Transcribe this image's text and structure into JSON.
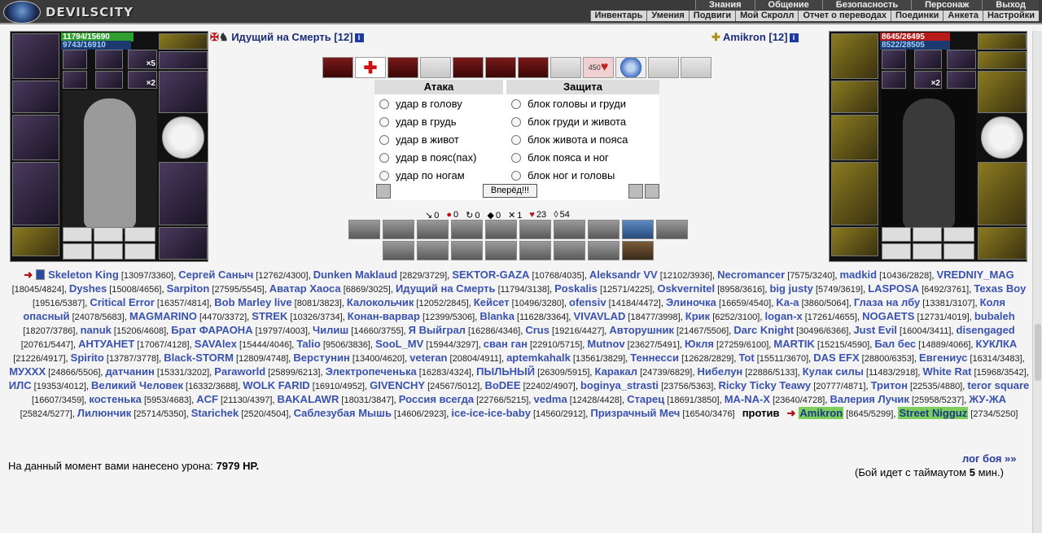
{
  "header": {
    "logo_text": "DEVILSCITY",
    "menu_top": [
      "Знания",
      "Общение",
      "Безопасность",
      "Персонаж",
      "Выход"
    ],
    "menu_bottom": [
      "Инвентарь",
      "Умения",
      "Подвиги",
      "Мой Скролл",
      "Отчет о переводах",
      "Поединки",
      "Анкета",
      "Настройки"
    ]
  },
  "player": {
    "name": "Идущий на Смерть",
    "level": "[12]",
    "hp": "11794/15690",
    "mp": "9743/16910",
    "hp_fraction": 0.752,
    "mp_fraction": 0.576,
    "slot_badges": [
      "×5",
      "×2"
    ]
  },
  "opponent": {
    "name": "Amikron",
    "level": "[12]",
    "hp": "8645/26495",
    "mp": "8522/28505",
    "hp_fraction": 0.326,
    "mp_fraction": 0.299,
    "slot_badges": [
      "×2"
    ]
  },
  "actions": {
    "heart_count": "450"
  },
  "attack": {
    "title": "Атака",
    "options": [
      "удар в голову",
      "удар в грудь",
      "удар в живот",
      "удар в пояс(пах)",
      "удар по ногам"
    ]
  },
  "defense": {
    "title": "Защита",
    "options": [
      "блок головы и груди",
      "блок груди и живота",
      "блок живота и пояса",
      "блок пояса и ног",
      "блок ног и головы"
    ]
  },
  "forward_button": "Вперёд!!!",
  "stats": [
    {
      "icon": "sword-icon",
      "glyph": "↘",
      "value": "0"
    },
    {
      "icon": "blood-icon",
      "glyph": "●",
      "value": "0"
    },
    {
      "icon": "dodge-icon",
      "glyph": "↻",
      "value": "0"
    },
    {
      "icon": "block-icon",
      "glyph": "◆",
      "value": "0"
    },
    {
      "icon": "crit-icon",
      "glyph": "✕",
      "value": "1"
    },
    {
      "icon": "heart-icon",
      "glyph": "♥",
      "value": "23"
    },
    {
      "icon": "shield-icon",
      "glyph": "◊",
      "value": "54"
    }
  ],
  "roster": {
    "team1": [
      {
        "name": "Skeleton King",
        "score": "[13097/3360]"
      },
      {
        "name": "Сергей Саныч",
        "score": "[12762/4300]"
      },
      {
        "name": "Dunken Maklaud",
        "score": "[2829/3729]"
      },
      {
        "name": "SEKTOR-GAZA",
        "score": "[10768/4035]"
      },
      {
        "name": "Aleksandr VV",
        "score": "[12102/3936]"
      },
      {
        "name": "Necromancer",
        "score": "[7575/3240]"
      },
      {
        "name": "madkid",
        "score": "[10436/2828]"
      },
      {
        "name": "VREDNIY_MAG",
        "score": "[18045/4824]"
      },
      {
        "name": "Dyshes",
        "score": "[15008/4656]"
      },
      {
        "name": "Sarpiton",
        "score": "[27595/5545]"
      },
      {
        "name": "Аватар Хаоса",
        "score": "[6869/3025]"
      },
      {
        "name": "Идущий на Смерть",
        "score": "[11794/3138]"
      },
      {
        "name": "Poskalis",
        "score": "[12571/4225]"
      },
      {
        "name": "Oskvernitel",
        "score": "[8958/3616]"
      },
      {
        "name": "big justy",
        "score": "[5749/3619]"
      },
      {
        "name": "LASPOSA",
        "score": "[6492/3761]"
      },
      {
        "name": "Texas Boy",
        "score": "[19516/5387]"
      },
      {
        "name": "Critical Error",
        "score": "[16357/4814]"
      },
      {
        "name": "Bob Marley live",
        "score": "[8081/3823]"
      },
      {
        "name": "Калокольчик",
        "score": "[12052/2845]"
      },
      {
        "name": "Кейсет",
        "score": "[10496/3280]"
      },
      {
        "name": "ofensiv",
        "score": "[14184/4472]"
      },
      {
        "name": "Элиночка",
        "score": "[16659/4540]"
      },
      {
        "name": "Ka-a",
        "score": "[3860/5064]"
      },
      {
        "name": "Глаза на лбу",
        "score": "[13381/3107]"
      },
      {
        "name": "Коля опасный",
        "score": "[24078/5683]"
      },
      {
        "name": "MAGMARINO",
        "score": "[4470/3372]"
      },
      {
        "name": "STREK",
        "score": "[10326/3734]"
      },
      {
        "name": "Конан-варвар",
        "score": "[12399/5306]"
      },
      {
        "name": "Blanka",
        "score": "[11628/3364]"
      },
      {
        "name": "VIVAVLAD",
        "score": "[18477/3998]"
      },
      {
        "name": "Крик",
        "score": "[6252/3100]"
      },
      {
        "name": "logan-x",
        "score": "[17261/4655]"
      },
      {
        "name": "NOGAETS",
        "score": "[12731/4019]"
      },
      {
        "name": "bubaleh",
        "score": "[18207/3786]"
      },
      {
        "name": "nanuk",
        "score": "[15206/4608]"
      },
      {
        "name": "Брат ФАРАОНА",
        "score": "[19797/4003]"
      },
      {
        "name": "Чилиш",
        "score": "[14660/3755]"
      },
      {
        "name": "Я Выйграл",
        "score": "[16286/4346]"
      },
      {
        "name": "Crus",
        "score": "[19216/4427]"
      },
      {
        "name": "Авторушник",
        "score": "[21467/5506]"
      },
      {
        "name": "Darc Knight",
        "score": "[30496/6366]"
      },
      {
        "name": "Just Evil",
        "score": "[16004/3411]"
      },
      {
        "name": "disengaged",
        "score": "[20761/5447]"
      },
      {
        "name": "АНТУАНЕТ",
        "score": "[17067/4128]"
      },
      {
        "name": "SAVAlex",
        "score": "[15444/4046]"
      },
      {
        "name": "Talio",
        "score": "[9506/3836]"
      },
      {
        "name": "SooL_MV",
        "score": "[15944/3297]"
      },
      {
        "name": "сван ган",
        "score": "[22910/5715]"
      },
      {
        "name": "Mutnov",
        "score": "[23627/5491]"
      },
      {
        "name": "Юкля",
        "score": "[27259/6100]"
      },
      {
        "name": "MARTIK",
        "score": "[15215/4590]"
      },
      {
        "name": "Бал бес",
        "score": "[14889/4066]"
      },
      {
        "name": "КУКЛКА",
        "score": "[21226/4917]"
      },
      {
        "name": "Spirito",
        "score": "[13787/3778]"
      },
      {
        "name": "Black-STORM",
        "score": "[12809/4748]"
      },
      {
        "name": "Верстунин",
        "score": "[13400/4620]"
      },
      {
        "name": "veteran",
        "score": "[20804/4911]"
      },
      {
        "name": "aptemkahalk",
        "score": "[13561/3829]"
      },
      {
        "name": "Теннесси",
        "score": "[12628/2829]"
      },
      {
        "name": "Tot",
        "score": "[15511/3670]"
      },
      {
        "name": "DAS EFX",
        "score": "[28800/6353]"
      },
      {
        "name": "Евгениус",
        "score": "[16314/3483]"
      },
      {
        "name": "МУХХХ",
        "score": "[24866/5506]"
      },
      {
        "name": "датчанин",
        "score": "[15331/3202]"
      },
      {
        "name": "Paraworld",
        "score": "[25899/6213]"
      },
      {
        "name": "Электропеченька",
        "score": "[16283/4324]"
      },
      {
        "name": "ПЫЛЬНЫЙ",
        "score": "[26309/5915]"
      },
      {
        "name": "Каракал",
        "score": "[24739/6829]"
      },
      {
        "name": "Нибелун",
        "score": "[22886/5133]"
      },
      {
        "name": "Кулак силы",
        "score": "[11483/2918]"
      },
      {
        "name": "White Rat",
        "score": "[15968/3542]"
      },
      {
        "name": "ИЛС",
        "score": "[19353/4012]"
      },
      {
        "name": "Великий Человек",
        "score": "[16332/3688]"
      },
      {
        "name": "WOLK FARID",
        "score": "[16910/4952]"
      },
      {
        "name": "GIVENCHY",
        "score": "[24567/5012]"
      },
      {
        "name": "BoDEE",
        "score": "[22402/4907]"
      },
      {
        "name": "boginya_strasti",
        "score": "[23756/5363]"
      },
      {
        "name": "Ricky Ticky Teawy",
        "score": "[20777/4871]"
      },
      {
        "name": "Тритон",
        "score": "[22535/4880]"
      },
      {
        "name": "teror square",
        "score": "[16607/3459]"
      },
      {
        "name": "костенька",
        "score": "[5953/4683]"
      },
      {
        "name": "ACF",
        "score": "[21130/4397]"
      },
      {
        "name": "BAKALAWR",
        "score": "[18031/3847]"
      },
      {
        "name": "Россия всегда",
        "score": "[22766/5215]"
      },
      {
        "name": "vedma",
        "score": "[12428/4428]"
      },
      {
        "name": "Старец",
        "score": "[18691/3850]"
      },
      {
        "name": "MA-NA-X",
        "score": "[23640/4728]"
      },
      {
        "name": "Валерия Лучик",
        "score": "[25958/5237]"
      },
      {
        "name": "ЖУ-ЖА",
        "score": "[25824/5277]"
      },
      {
        "name": "Лилюнчик",
        "score": "[25714/5350]"
      },
      {
        "name": "Starichek",
        "score": "[2520/4504]"
      },
      {
        "name": "Саблезубая Мышь",
        "score": "[14606/2923]"
      },
      {
        "name": "ice-ice-ice-baby",
        "score": "[14560/2912]"
      },
      {
        "name": "Призрачный Меч",
        "score": "[16540/3476]"
      }
    ],
    "versus": "против",
    "team2": [
      {
        "name": "Amikron",
        "score": "[8645/5299]"
      },
      {
        "name": "Street Nigguz",
        "score": "[2734/5250]"
      }
    ]
  },
  "damage": {
    "label": "На данный момент вами нанесено урона:",
    "value": "7979 HP."
  },
  "log_link": "лог боя »»",
  "timeout": {
    "prefix": "(Бой идет с таймаутом",
    "value": "5",
    "suffix": "мин.)"
  }
}
